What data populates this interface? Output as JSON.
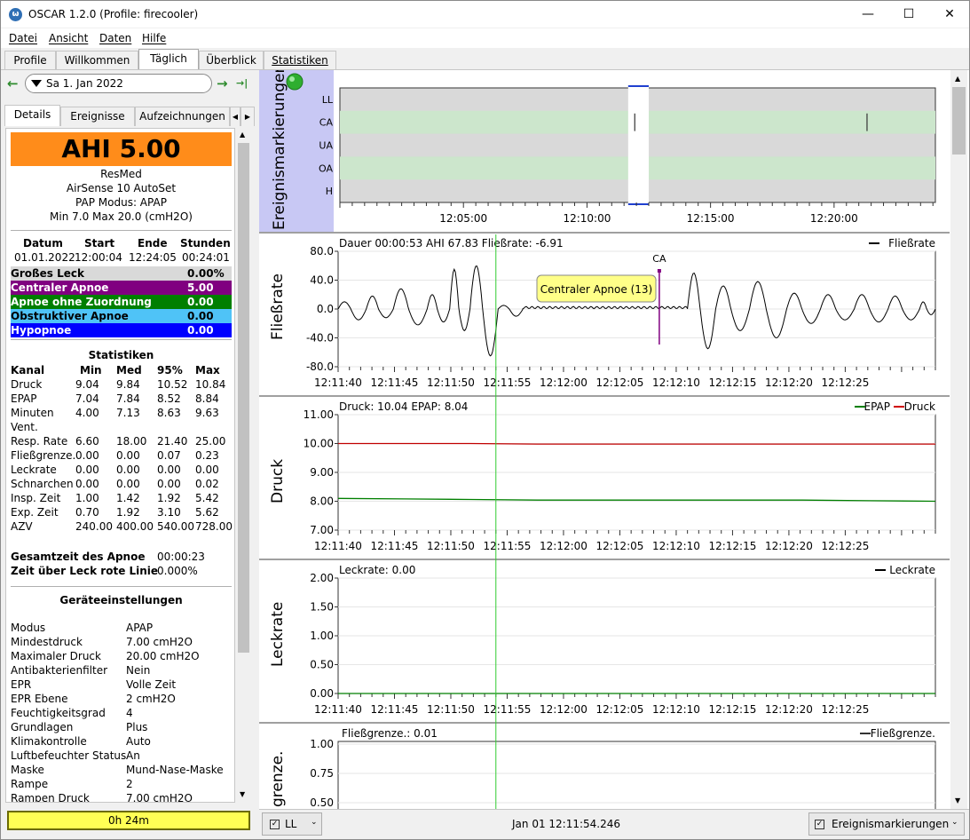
{
  "window": {
    "title": "OSCAR 1.2.0 (Profile: firecooler)",
    "minimize": "—",
    "maximize": "☐",
    "close": "✕"
  },
  "menu": [
    "Datei",
    "Ansicht",
    "Daten",
    "Hilfe"
  ],
  "tabs": [
    "Profile",
    "Willkommen",
    "Täglich",
    "Überblick",
    "Statistiken"
  ],
  "date": {
    "value": "Sa 1. Jan 2022",
    "prev": "←",
    "next": "→",
    "last": "→|"
  },
  "subtabs": [
    "Details",
    "Ereignisse",
    "Aufzeichnungen"
  ],
  "details": {
    "ahi": "AHI 5.00",
    "device": [
      "ResMed",
      "AirSense 10 AutoSet",
      "PAP Modus: APAP",
      "Min 7.0 Max 20.0 (cmH2O)"
    ],
    "session_headers": [
      "Datum",
      "Start",
      "Ende",
      "Stunden"
    ],
    "session": [
      "01.01.2022",
      "12:00:04",
      "12:24:05",
      "00:24:01"
    ],
    "events": [
      {
        "label": "Großes Leck",
        "value": "0.00%",
        "bg": "#d9d9d9",
        "fg": "#000000"
      },
      {
        "label": "Centraler Apnoe",
        "value": "5.00",
        "bg": "#800080",
        "fg": "#ffffff"
      },
      {
        "label": "Apnoe ohne Zuordnung",
        "value": "0.00",
        "bg": "#007f00",
        "fg": "#ffffff"
      },
      {
        "label": "Obstruktiver Apnoe",
        "value": "0.00",
        "bg": "#4fc3f7",
        "fg": "#000000"
      },
      {
        "label": "Hypopnoe",
        "value": "0.00",
        "bg": "#0000ff",
        "fg": "#ffffff"
      }
    ],
    "stats_title": "Statistiken",
    "stats_headers": [
      "Kanal",
      "Min",
      "Med",
      "95%",
      "Max"
    ],
    "stats": [
      [
        "Druck",
        "9.04",
        "9.84",
        "10.52",
        "10.84"
      ],
      [
        "EPAP",
        "7.04",
        "7.84",
        "8.52",
        "8.84"
      ],
      [
        "Minuten",
        "4.00",
        "7.13",
        "8.63",
        "9.63"
      ],
      [
        "Vent.",
        "",
        "",
        "",
        ""
      ],
      [
        "Resp. Rate",
        "6.60",
        "18.00",
        "21.40",
        "25.00"
      ],
      [
        "Fließgrenze.",
        "0.00",
        "0.00",
        "0.07",
        "0.23"
      ],
      [
        "Leckrate",
        "0.00",
        "0.00",
        "0.00",
        "0.00"
      ],
      [
        "Schnarchen",
        "0.00",
        "0.00",
        "0.00",
        "0.02"
      ],
      [
        "Insp. Zeit",
        "1.00",
        "1.42",
        "1.92",
        "5.42"
      ],
      [
        "Exp. Zeit",
        "0.70",
        "1.92",
        "3.10",
        "5.62"
      ],
      [
        "AZV",
        "240.00",
        "400.00",
        "540.00",
        "728.00"
      ]
    ],
    "apnea_time_label": "Gesamtzeit des Apnoe",
    "apnea_time": "00:00:23",
    "leak_label": "Zeit über Leck rote Linie",
    "leak": "0.000%",
    "settings_title": "Geräteeinstellungen",
    "settings": [
      [
        "Modus",
        "APAP"
      ],
      [
        "Mindestdruck",
        "7.00 cmH2O"
      ],
      [
        "Maximaler Druck",
        "20.00 cmH2O"
      ],
      [
        "Antibakterienfilter",
        "Nein"
      ],
      [
        "EPR",
        "Volle Zeit"
      ],
      [
        "EPR Ebene",
        "2 cmH2O"
      ],
      [
        "Feuchtigkeitsgrad",
        "4"
      ],
      [
        "Grundlagen",
        "Plus"
      ],
      [
        "Klimakontrolle",
        "Auto"
      ],
      [
        "Luftbefeuchter Status",
        "An"
      ],
      [
        "Maske",
        "Mund-Nase-Maske"
      ],
      [
        "Rampe",
        "2"
      ],
      [
        "Rampen Druck",
        "7.00 cmH2O"
      ]
    ],
    "duration": "0h 24m"
  },
  "bottom": {
    "combo": "LL",
    "timestamp": "Jan 01 12:11:54.246",
    "events_toggle": "Ereignismarkierungen"
  },
  "chart_data": [
    {
      "type": "scatter",
      "ylabel": "Ereignismarkierungen",
      "categories": [
        "LL",
        "CA",
        "UA",
        "OA",
        "H"
      ],
      "x_ticks": [
        "12:05:00",
        "12:10:00",
        "12:15:00",
        "12:20:00"
      ],
      "events": [
        {
          "type": "CA",
          "time": "12:11:56"
        },
        {
          "type": "CA",
          "time": "12:21:20"
        }
      ],
      "selection": [
        "12:11:40",
        "12:12:30"
      ]
    },
    {
      "type": "line",
      "ylabel": "Fließrate",
      "info": "Dauer 00:00:53 AHI 67.83 Fließrate: -6.91",
      "legend": [
        "Fließrate"
      ],
      "ylim": [
        -80,
        80
      ],
      "y_ticks": [
        "80.0",
        "40.0",
        "0.0",
        "-40.0",
        "-80.0"
      ],
      "x_ticks": [
        "12:11:40",
        "12:11:45",
        "12:11:50",
        "12:11:55",
        "12:12:00",
        "12:12:05",
        "12:12:10",
        "12:12:15",
        "12:12:20",
        "12:12:25"
      ],
      "annotation": "CA",
      "tooltip": "Centraler Apnoe (13)"
    },
    {
      "type": "line",
      "ylabel": "Druck",
      "info": "Druck: 10.04 EPAP: 8.04",
      "legend": [
        "EPAP",
        "Druck"
      ],
      "ylim": [
        7,
        11
      ],
      "y_ticks": [
        "11.00",
        "10.00",
        "9.00",
        "8.00",
        "7.00"
      ],
      "x_ticks": [
        "12:11:40",
        "12:11:45",
        "12:11:50",
        "12:11:55",
        "12:12:00",
        "12:12:05",
        "12:12:10",
        "12:12:15",
        "12:12:20",
        "12:12:25"
      ],
      "series": [
        {
          "name": "EPAP",
          "values": [
            8.1,
            8.08,
            8.06,
            8.04,
            8.04,
            8.04,
            8.04,
            8.04,
            8.02,
            8.0
          ]
        },
        {
          "name": "Druck",
          "values": [
            10.0,
            10.0,
            10.0,
            9.98,
            9.98,
            9.98,
            9.98,
            9.98,
            9.98,
            9.98
          ]
        }
      ]
    },
    {
      "type": "line",
      "ylabel": "Leckrate",
      "info": "Leckrate: 0.00",
      "legend": [
        "Leckrate"
      ],
      "ylim": [
        0,
        2
      ],
      "y_ticks": [
        "2.00",
        "1.50",
        "1.00",
        "0.50",
        "0.00"
      ],
      "x_ticks": [
        "12:11:40",
        "12:11:45",
        "12:11:50",
        "12:11:55",
        "12:12:00",
        "12:12:05",
        "12:12:10",
        "12:12:15",
        "12:12:20",
        "12:12:25"
      ]
    },
    {
      "type": "line",
      "ylabel": "grenze.",
      "info": "Fließgrenze.: 0.01",
      "legend": [
        "Fließgrenze."
      ],
      "y_ticks": [
        "1.00",
        "0.75",
        "0.50"
      ]
    }
  ]
}
